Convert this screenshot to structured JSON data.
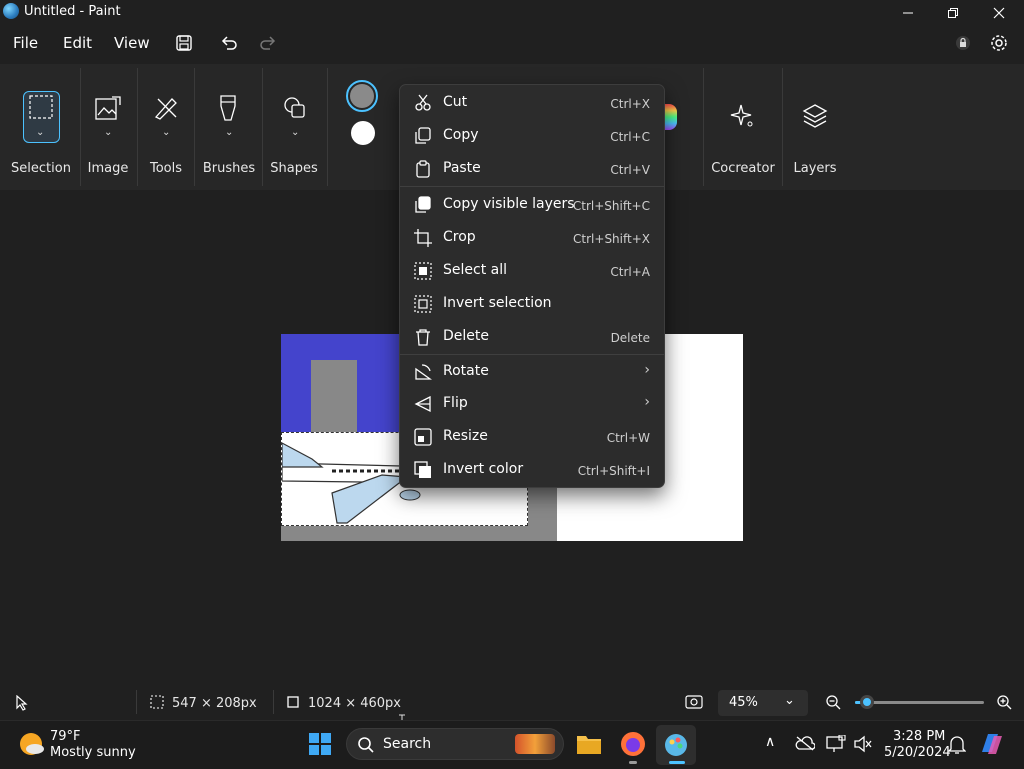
{
  "window": {
    "title": "Untitled - Paint"
  },
  "menu": {
    "file": "File",
    "edit": "Edit",
    "view": "View"
  },
  "ribbon": {
    "groups": [
      {
        "label": "Selection",
        "icon": "selection-icon"
      },
      {
        "label": "Image",
        "icon": "image-icon"
      },
      {
        "label": "Tools",
        "icon": "tools-icon"
      },
      {
        "label": "Brushes",
        "icon": "brush-icon"
      },
      {
        "label": "Shapes",
        "icon": "shapes-icon"
      },
      {
        "label": "Cocreator",
        "icon": "sparkle-icon"
      },
      {
        "label": "Layers",
        "icon": "layers-icon"
      }
    ],
    "colors": {
      "primary": "#8a8a8a",
      "secondary": "#ffffff"
    }
  },
  "context_menu": {
    "items": [
      {
        "label": "Cut",
        "shortcut": "Ctrl+X",
        "icon": "scissors-icon"
      },
      {
        "label": "Copy",
        "shortcut": "Ctrl+C",
        "icon": "copy-icon"
      },
      {
        "label": "Paste",
        "shortcut": "Ctrl+V",
        "icon": "paste-icon"
      },
      {
        "label": "Copy visible layers",
        "shortcut": "Ctrl+Shift+C",
        "icon": "copy-layers-icon"
      },
      {
        "label": "Crop",
        "shortcut": "Ctrl+Shift+X",
        "icon": "crop-icon"
      },
      {
        "label": "Select all",
        "shortcut": "Ctrl+A",
        "icon": "select-all-icon"
      },
      {
        "label": "Invert selection",
        "shortcut": "",
        "icon": "invert-selection-icon"
      },
      {
        "label": "Delete",
        "shortcut": "Delete",
        "icon": "trash-icon"
      },
      {
        "label": "Rotate",
        "shortcut": "",
        "icon": "rotate-icon"
      },
      {
        "label": "Flip",
        "shortcut": "",
        "icon": "flip-icon"
      },
      {
        "label": "Resize",
        "shortcut": "Ctrl+W",
        "icon": "resize-icon"
      },
      {
        "label": "Invert color",
        "shortcut": "Ctrl+Shift+I",
        "icon": "invert-color-icon"
      }
    ]
  },
  "status": {
    "selection_size": "547 × 208px",
    "canvas_size": "1024 × 460px",
    "zoom": "45%",
    "zoom_level": 0.05
  },
  "taskbar": {
    "weather_temp": "79°F",
    "weather_desc": "Mostly sunny",
    "search_placeholder": "Search",
    "time": "3:28 PM",
    "date": "5/20/2024"
  },
  "colors": {
    "accent": "#4cc2ff",
    "canvas_blue": "#4444cc",
    "canvas_gray": "#888888"
  }
}
